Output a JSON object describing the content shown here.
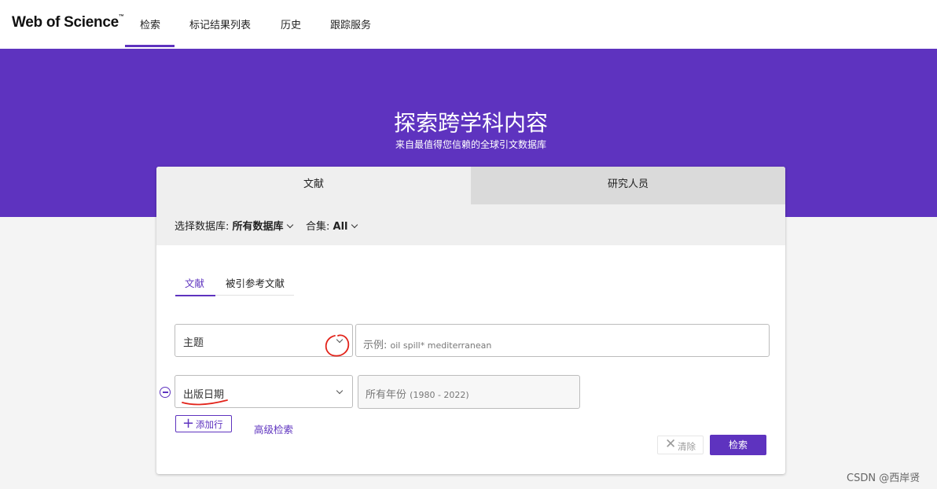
{
  "nav": {
    "logo": "Web of Science",
    "logo_tm": "™",
    "items": [
      "检索",
      "标记结果列表",
      "历史",
      "跟踪服务"
    ]
  },
  "hero": {
    "title": "探索跨学科内容",
    "subtitle": "来自最值得您信赖的全球引文数据库"
  },
  "tabs": {
    "documents": "文献",
    "researchers": "研究人员"
  },
  "database": {
    "label": "选择数据库:",
    "value": "所有数据库",
    "collection_label": "合集:",
    "collection_value": "All"
  },
  "subtabs": {
    "documents": "文献",
    "cited_refs": "被引参考文献"
  },
  "row1": {
    "field": "主题",
    "placeholder_prefix": "示例: ",
    "placeholder_example": "oil spill* mediterranean"
  },
  "row2": {
    "field": "出版日期",
    "value_main": "所有年份",
    "value_range": "(1980 - 2022)"
  },
  "actions": {
    "add_row": "添加行",
    "advanced": "高级检索",
    "clear": "清除",
    "search": "检索"
  },
  "watermark": "CSDN @西岸贤",
  "colors": {
    "accent": "#5e33bf",
    "annotation": "#e2231a"
  }
}
